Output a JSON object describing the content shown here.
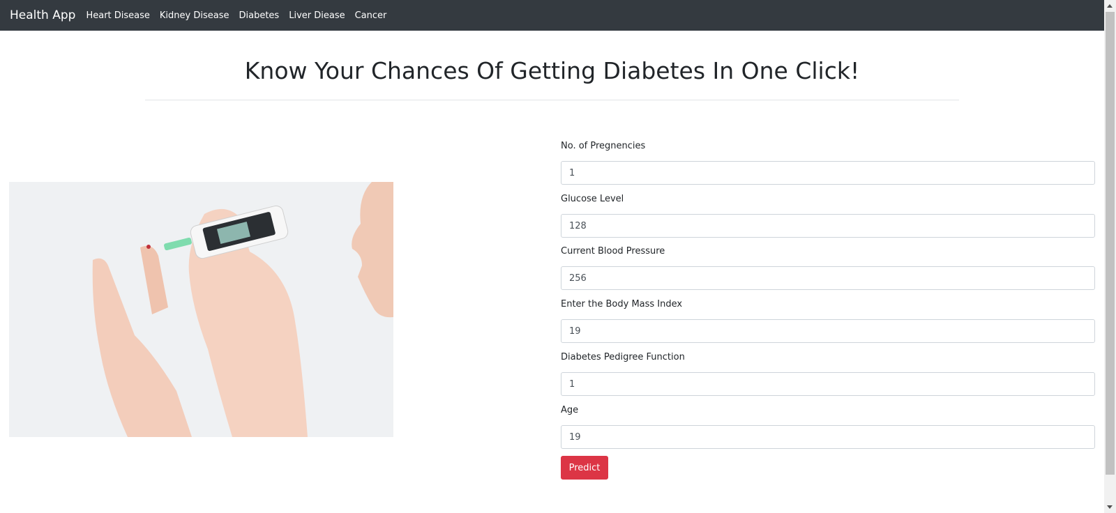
{
  "navbar": {
    "brand": "Health App",
    "links": [
      "Heart Disease",
      "Kidney Disease",
      "Diabetes",
      "Liver Diease",
      "Cancer"
    ]
  },
  "page": {
    "title": "Know Your Chances Of Getting Diabetes In One Click!"
  },
  "form": {
    "fields": [
      {
        "label": "No. of Pregnencies",
        "value": "1"
      },
      {
        "label": "Glucose Level",
        "value": "128"
      },
      {
        "label": "Current Blood Pressure",
        "value": "256"
      },
      {
        "label": "Enter the Body Mass Index",
        "value": "19"
      },
      {
        "label": "Diabetes Pedigree Function",
        "value": "1"
      },
      {
        "label": "Age",
        "value": "19"
      }
    ],
    "submit_label": "Predict"
  },
  "colors": {
    "navbar": "#343a40",
    "button": "#dc3545"
  }
}
